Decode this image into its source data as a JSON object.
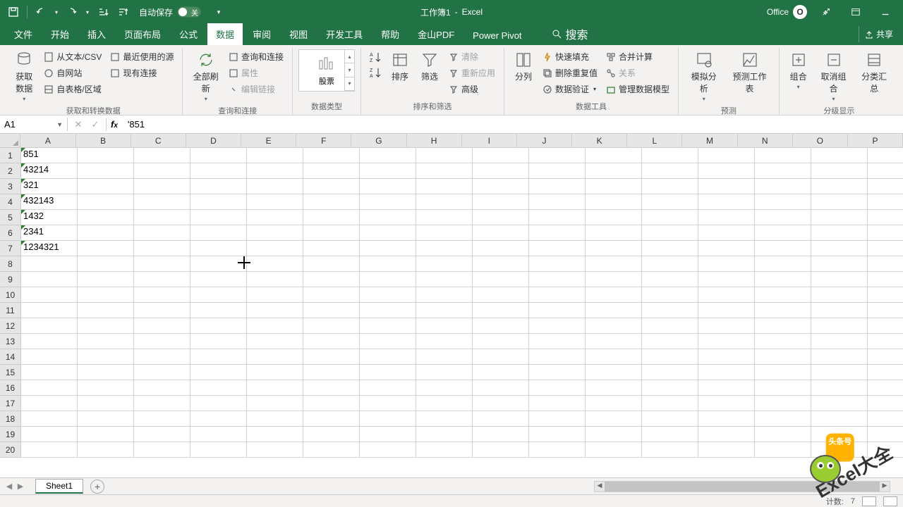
{
  "title": {
    "doc": "工作簿1",
    "sep": "-",
    "app": "Excel"
  },
  "qat": {
    "autosave_label": "自动保存",
    "autosave_off": "关"
  },
  "office": {
    "label": "Office",
    "badge": "O"
  },
  "tabs": [
    "文件",
    "开始",
    "插入",
    "页面布局",
    "公式",
    "数据",
    "审阅",
    "视图",
    "开发工具",
    "帮助",
    "金山PDF",
    "Power Pivot"
  ],
  "active_tab": "数据",
  "search_label": "搜索",
  "share_label": "共享",
  "ribbon": {
    "g_aquire": {
      "big": "获取数据",
      "items": [
        "从文本/CSV",
        "自网站",
        "自表格/区域",
        "最近使用的源",
        "现有连接"
      ],
      "label": "获取和转换数据"
    },
    "g_query": {
      "big": "全部刷新",
      "items": [
        "查询和连接",
        "属性",
        "编辑链接"
      ],
      "label": "查询和连接"
    },
    "g_datatype": {
      "gallery": "股票",
      "label": "数据类型"
    },
    "g_sort": {
      "big_sort": "排序",
      "big_filter": "筛选",
      "items": [
        "清除",
        "重新应用",
        "高级"
      ],
      "label": "排序和筛选"
    },
    "g_tools": {
      "big": "分列",
      "items": [
        "快速填充",
        "删除重复值",
        "数据验证",
        "合并计算",
        "关系",
        "管理数据模型"
      ],
      "label": "数据工具"
    },
    "g_forecast": {
      "big1": "模拟分析",
      "big2": "预测工作表",
      "label": "预测"
    },
    "g_outline": {
      "big1": "组合",
      "big2": "取消组合",
      "big3": "分类汇总",
      "label": "分级显示"
    }
  },
  "name_box": "A1",
  "formula": "'851",
  "columns": [
    "A",
    "B",
    "C",
    "D",
    "E",
    "F",
    "G",
    "H",
    "I",
    "J",
    "K",
    "L",
    "M",
    "N",
    "O",
    "P"
  ],
  "row_count": 20,
  "chart_data": {
    "type": "table",
    "note": "Column A contains text-formatted numbers (leading apostrophe)",
    "rows": [
      [
        "851"
      ],
      [
        "43214"
      ],
      [
        "321"
      ],
      [
        "432143"
      ],
      [
        "1432"
      ],
      [
        "2341"
      ],
      [
        "1234321"
      ]
    ]
  },
  "sheet": {
    "name": "Sheet1"
  },
  "status": {
    "count_label": "计数:",
    "count": "7"
  },
  "watermark": {
    "text": "Excel大全",
    "bubble": "头条号"
  }
}
